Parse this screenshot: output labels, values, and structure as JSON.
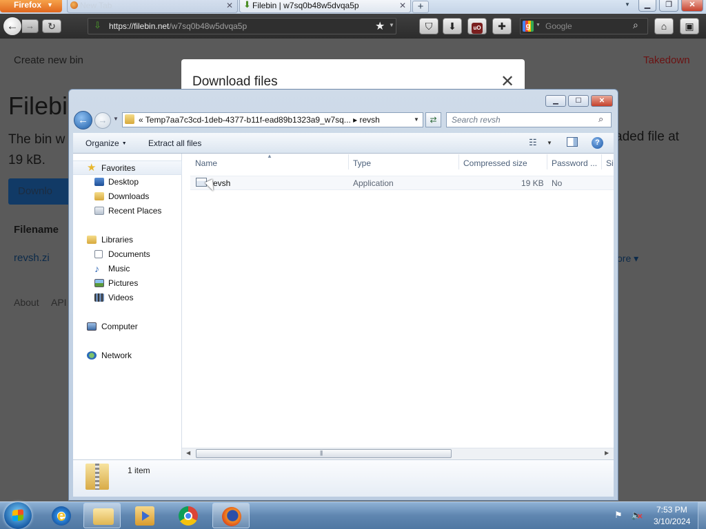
{
  "browser": {
    "menu_label": "Firefox",
    "tabs": [
      {
        "title": "New Tab"
      },
      {
        "title": "Filebin | w7sq0b48w5dvqa5p"
      }
    ],
    "url_host": "https://filebin.net",
    "url_path": "/w7sq0b48w5dvqa5p",
    "search_placeholder": "Google"
  },
  "page": {
    "create_new_bin": "Create new bin",
    "takedown": "Takedown",
    "title": "Filebi",
    "description_line1": "The bin w",
    "description_line2": "19 kB.",
    "description_right": "aded file at",
    "download_label": "Downlo",
    "filename_header": "Filename",
    "file_name": "revsh.zi",
    "more_label": "ore ▾",
    "footer_about": "About",
    "footer_api": "API"
  },
  "modal": {
    "title": "Download files",
    "close_glyph": "✕"
  },
  "explorer": {
    "address_path": "«  Temp7aa7c3cd-1deb-4377-b11f-ead89b1323a9_w7sq...  ▸  revsh",
    "search_placeholder": "Search revsh",
    "toolbar": {
      "organize": "Organize",
      "extract_all": "Extract all files"
    },
    "nav": [
      {
        "label": "Favorites",
        "indent": 0
      },
      {
        "label": "Desktop",
        "indent": 1
      },
      {
        "label": "Downloads",
        "indent": 1
      },
      {
        "label": "Recent Places",
        "indent": 1
      },
      {
        "label": "Libraries",
        "indent": 0
      },
      {
        "label": "Documents",
        "indent": 1
      },
      {
        "label": "Music",
        "indent": 1
      },
      {
        "label": "Pictures",
        "indent": 1
      },
      {
        "label": "Videos",
        "indent": 1
      },
      {
        "label": "Computer",
        "indent": 0
      },
      {
        "label": "Network",
        "indent": 0
      }
    ],
    "columns": {
      "name": "Name",
      "type": "Type",
      "compressed_size": "Compressed size",
      "password": "Password ...",
      "size": "Si"
    },
    "files": [
      {
        "name": "revsh",
        "type": "Application",
        "compressed_size": "19 KB",
        "password": "No"
      }
    ],
    "details_count": "1 item"
  },
  "taskbar": {
    "clock_time": "7:53 PM",
    "clock_date": "3/10/2024"
  }
}
